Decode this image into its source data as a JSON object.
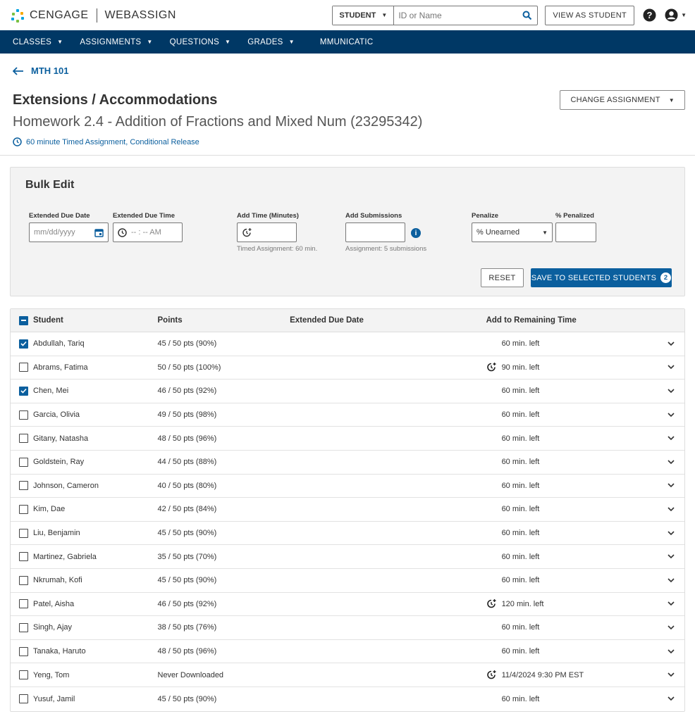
{
  "brand": {
    "name": "CENGAGE",
    "product": "WEBASSIGN"
  },
  "search": {
    "scope": "STUDENT",
    "placeholder": "ID or Name"
  },
  "header": {
    "view_as_label": "VIEW AS STUDENT"
  },
  "nav": {
    "items": [
      {
        "label": "CLASSES"
      },
      {
        "label": "ASSIGNMENTS"
      },
      {
        "label": "QUESTIONS"
      },
      {
        "label": "GRADES"
      },
      {
        "label": "MMUNICATIC"
      }
    ]
  },
  "page": {
    "back_label": "MTH 101",
    "title": "Extensions / Accommodations",
    "change_assignment_label": "CHANGE ASSIGNMENT",
    "assignment_title": "Homework 2.4 - Addition of Fractions and Mixed Num (23295342)",
    "timed_info": "60 minute Timed Assignment, Conditional Release"
  },
  "bulk_edit": {
    "title": "Bulk Edit",
    "due_date_label": "Extended Due Date",
    "due_date_placeholder": "mm/dd/yyyy",
    "due_time_label": "Extended Due Time",
    "due_time_placeholder": "-- : -- AM",
    "add_time_label": "Add Time (Minutes)",
    "add_time_hint": "Timed Assignment: 60 min.",
    "add_submissions_label": "Add Submissions",
    "add_submissions_hint": "Assignment: 5 submissions",
    "penalize_label": "Penalize",
    "penalize_value": "% Unearned",
    "percent_label": "% Penalized",
    "reset_label": "RESET",
    "save_label": "SAVE TO SELECTED STUDENTS",
    "selected_count": "2"
  },
  "table": {
    "headers": {
      "student": "Student",
      "points": "Points",
      "due": "Extended Due Date",
      "time": "Add to Remaining Time"
    },
    "rows": [
      {
        "name": "Abdullah, Tariq",
        "points": "45 / 50 pts (90%)",
        "due": "",
        "time": "60 min. left",
        "checked": true,
        "icon": false
      },
      {
        "name": "Abrams, Fatima",
        "points": "50 / 50 pts (100%)",
        "due": "",
        "time": "90 min. left",
        "checked": false,
        "icon": true
      },
      {
        "name": "Chen, Mei",
        "points": "46 / 50 pts (92%)",
        "due": "",
        "time": "60 min. left",
        "checked": true,
        "icon": false
      },
      {
        "name": "Garcia, Olivia",
        "points": "49 / 50 pts (98%)",
        "due": "",
        "time": "60 min. left",
        "checked": false,
        "icon": false
      },
      {
        "name": "Gitany, Natasha",
        "points": "48 / 50 pts (96%)",
        "due": "",
        "time": "60 min. left",
        "checked": false,
        "icon": false
      },
      {
        "name": "Goldstein, Ray",
        "points": "44 / 50 pts (88%)",
        "due": "",
        "time": "60 min. left",
        "checked": false,
        "icon": false
      },
      {
        "name": "Johnson, Cameron",
        "points": "40 / 50 pts (80%)",
        "due": "",
        "time": "60 min. left",
        "checked": false,
        "icon": false
      },
      {
        "name": "Kim, Dae",
        "points": "42 / 50 pts (84%)",
        "due": "",
        "time": "60 min. left",
        "checked": false,
        "icon": false
      },
      {
        "name": "Liu, Benjamin",
        "points": "45 / 50 pts (90%)",
        "due": "",
        "time": "60 min. left",
        "checked": false,
        "icon": false
      },
      {
        "name": "Martinez, Gabriela",
        "points": "35 / 50 pts (70%)",
        "due": "",
        "time": "60 min. left",
        "checked": false,
        "icon": false
      },
      {
        "name": "Nkrumah, Kofi",
        "points": "45 / 50 pts (90%)",
        "due": "",
        "time": "60 min. left",
        "checked": false,
        "icon": false
      },
      {
        "name": "Patel, Aisha",
        "points": "46 / 50 pts (92%)",
        "due": "",
        "time": "120 min. left",
        "checked": false,
        "icon": true
      },
      {
        "name": "Singh, Ajay",
        "points": "38 / 50 pts (76%)",
        "due": "",
        "time": "60 min. left",
        "checked": false,
        "icon": false
      },
      {
        "name": "Tanaka, Haruto",
        "points": "48 / 50 pts (96%)",
        "due": "",
        "time": "60 min. left",
        "checked": false,
        "icon": false
      },
      {
        "name": "Yeng, Tom",
        "points": "Never Downloaded",
        "due": "",
        "time": "11/4/2024 9:30 PM EST",
        "checked": false,
        "icon": true
      },
      {
        "name": "Yusuf, Jamil",
        "points": "45 / 50 pts (90%)",
        "due": "",
        "time": "60 min. left",
        "checked": false,
        "icon": false
      }
    ]
  },
  "colors": {
    "nav_bg": "#003865",
    "accent": "#0b5f9e"
  },
  "icons": {
    "back": "arrow-left-icon",
    "clock": "clock-icon",
    "add_time": "clock-plus-icon",
    "expand": "chevron-down-icon"
  }
}
